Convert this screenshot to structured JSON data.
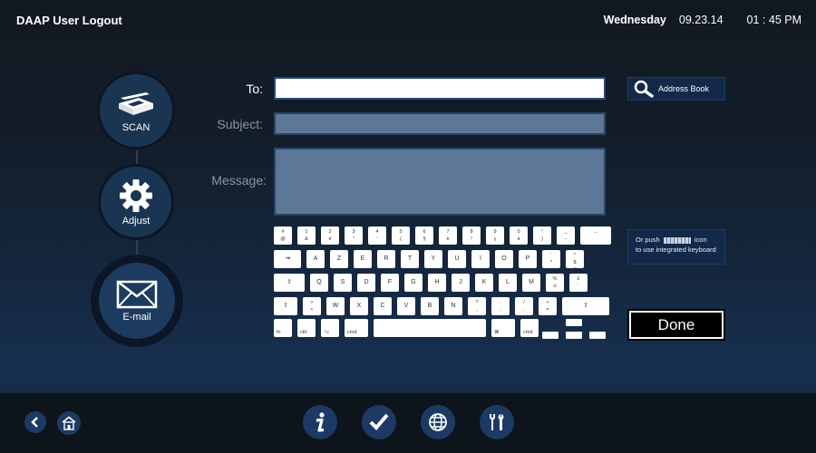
{
  "header": {
    "title": "DAAP User Logout",
    "day": "Wednesday",
    "date": "09.23.14",
    "time": "01 : 45 PM"
  },
  "workflow": {
    "steps": [
      {
        "label": "SCAN",
        "icon": "scanner-icon"
      },
      {
        "label": "Adjust",
        "icon": "gear-icon"
      },
      {
        "label": "E-mail",
        "icon": "envelope-icon",
        "active": true
      }
    ]
  },
  "form": {
    "to_label": "To:",
    "to_value": "",
    "subject_label": "Subject:",
    "subject_value": "",
    "message_label": "Message:",
    "message_value": ""
  },
  "address_book": {
    "label": "Address Book",
    "icon": "search-icon"
  },
  "keyboard_hint": {
    "line1_before": "Or push",
    "line1_after": "icon",
    "line2": "to use integrated keyboard"
  },
  "done_label": "Done",
  "keyboard": {
    "row1": [
      "# @",
      "1 &",
      "2 é",
      "3 \"",
      "4 '",
      "5 (",
      "6 §",
      "7 è",
      "8 !",
      "9 ç",
      "0 à",
      "° )",
      "_ -",
      "←"
    ],
    "row2": [
      "⇥",
      "A",
      "Z",
      "E",
      "R",
      "T",
      "Y",
      "U",
      "I",
      "O",
      "P",
      "¨ ^",
      "* $ €"
    ],
    "row3": [
      "⇪",
      "Q",
      "S",
      "D",
      "F",
      "G",
      "H",
      "J",
      "K",
      "L",
      "M",
      "% ù",
      "£ `"
    ],
    "row4": [
      "⇧",
      "> <",
      "W",
      "X",
      "C",
      "V",
      "B",
      "N",
      "? ,",
      ". ;",
      "/ :",
      "+ =",
      "⇧"
    ],
    "row5": [
      "fn",
      "ctrl",
      "⌥",
      "cmd",
      "",
      "⌘",
      "cmd",
      "⌥"
    ]
  },
  "bottom": {
    "back_icon": "chevron-left-icon",
    "home_icon": "home-icon",
    "info_icon": "info-icon",
    "check_icon": "checkmark-icon",
    "globe_icon": "globe-icon",
    "tools_icon": "tools-icon"
  },
  "colors": {
    "accent": "#1c3a64",
    "panel": "#13294a",
    "disabled_field": "#5d7796"
  }
}
